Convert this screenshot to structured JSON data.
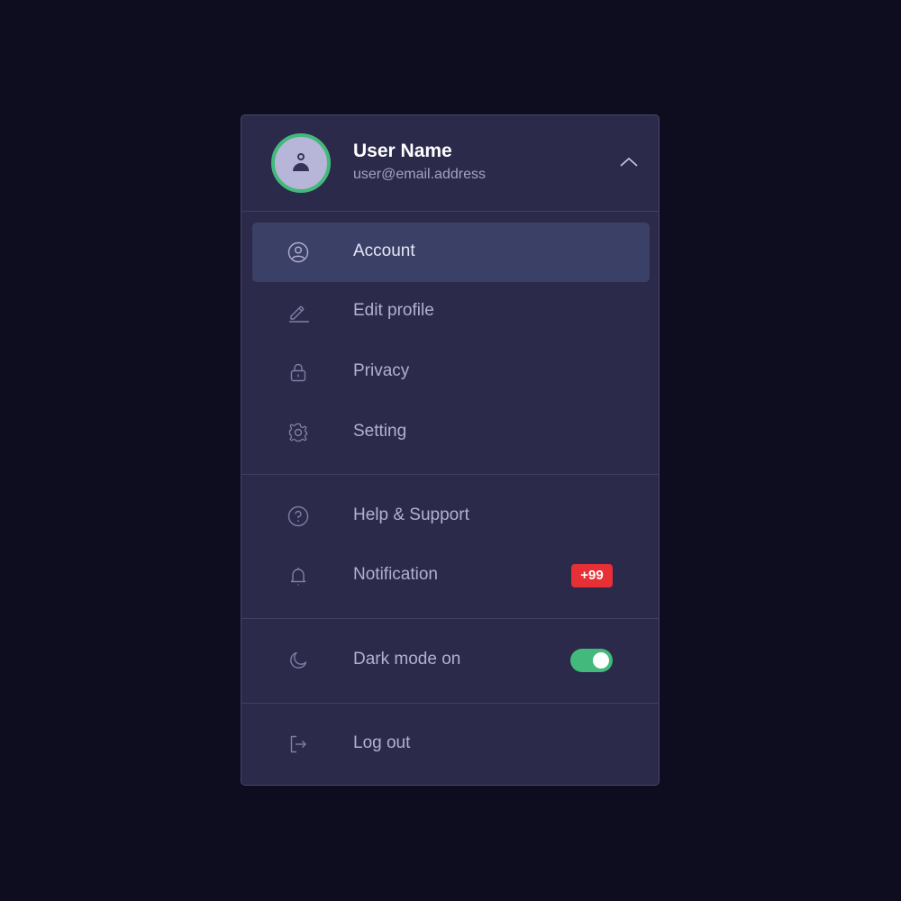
{
  "user": {
    "name": "User Name",
    "email": "user@email.address"
  },
  "menu": {
    "items": [
      {
        "label": "Account",
        "icon": "user-circle-icon",
        "active": true
      },
      {
        "label": "Edit profile",
        "icon": "pencil-icon"
      },
      {
        "label": "Privacy",
        "icon": "lock-icon"
      },
      {
        "label": "Setting",
        "icon": "gear-icon"
      },
      {
        "label": "Help & Support",
        "icon": "question-circle-icon"
      },
      {
        "label": "Notification",
        "icon": "bell-icon",
        "badge": "+99"
      },
      {
        "label": "Dark mode on",
        "icon": "moon-icon",
        "toggle": true
      },
      {
        "label": "Log out",
        "icon": "logout-icon"
      }
    ]
  },
  "colors": {
    "background": "#0e0d20",
    "panel": "#2b2a4a",
    "active_item": "#3b4066",
    "accent_green": "#43b97c",
    "badge_red": "#e63035"
  }
}
